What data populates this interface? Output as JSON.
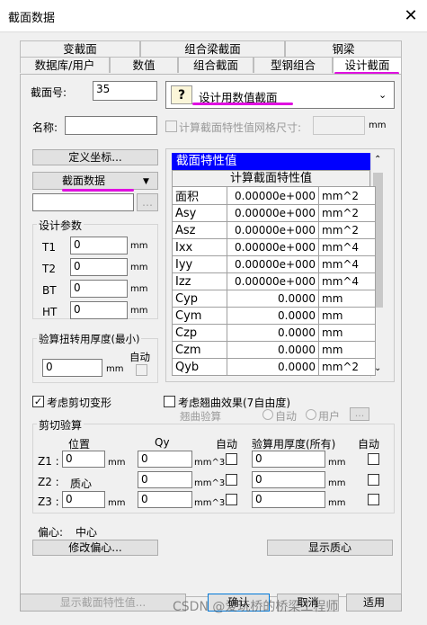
{
  "window": {
    "title": "截面数据",
    "close_glyph": "✕"
  },
  "tabs_back": [
    "变截面",
    "组合梁截面",
    "钢梁"
  ],
  "tabs_front": [
    "数据库/用户",
    "数值",
    "组合截面",
    "型钢组合",
    "设计截面"
  ],
  "section_no": {
    "label": "截面号:",
    "value": "35"
  },
  "section_type": {
    "value": "设计用数值截面"
  },
  "name": {
    "label": "名称:",
    "value": ""
  },
  "grid_size": {
    "label": "计算截面特性值网格尺寸:",
    "unit": "mm"
  },
  "define_coord_button": "定义坐标...",
  "section_data_dropdown": "截面数据",
  "design_params": {
    "title": "设计参数",
    "rows": [
      {
        "label": "T1",
        "value": "0",
        "unit": "mm"
      },
      {
        "label": "T2",
        "value": "0",
        "unit": "mm"
      },
      {
        "label": "BT",
        "value": "0",
        "unit": "mm"
      },
      {
        "label": "HT",
        "value": "0",
        "unit": "mm"
      }
    ]
  },
  "torsion": {
    "title": "验算扭转用厚度(最小)",
    "value": "0",
    "unit": "mm",
    "auto_label": "自动"
  },
  "props": {
    "header": "截面特性值",
    "calc_button": "计算截面特性值",
    "rows": [
      {
        "name": "面积",
        "value": "0.00000e+000",
        "unit": "mm^2"
      },
      {
        "name": "Asy",
        "value": "0.00000e+000",
        "unit": "mm^2"
      },
      {
        "name": "Asz",
        "value": "0.00000e+000",
        "unit": "mm^2"
      },
      {
        "name": "Ixx",
        "value": "0.00000e+000",
        "unit": "mm^4"
      },
      {
        "name": "Iyy",
        "value": "0.00000e+000",
        "unit": "mm^4"
      },
      {
        "name": "Izz",
        "value": "0.00000e+000",
        "unit": "mm^4"
      },
      {
        "name": "Cyp",
        "value": "0.0000",
        "unit": "mm"
      },
      {
        "name": "Cym",
        "value": "0.0000",
        "unit": "mm"
      },
      {
        "name": "Czp",
        "value": "0.0000",
        "unit": "mm"
      },
      {
        "name": "Czm",
        "value": "0.0000",
        "unit": "mm"
      },
      {
        "name": "Qyb",
        "value": "0.0000",
        "unit": "mm^2"
      }
    ]
  },
  "shear_deform": {
    "label": "考虑剪切变形",
    "checked": true
  },
  "warping": {
    "label": "考虑翘曲效果(7自由度)",
    "sub_label": "翘曲验算",
    "auto": "自动",
    "user": "用户",
    "more": "..."
  },
  "shear_check": {
    "title": "剪切验算",
    "col_pos": "位置",
    "col_qy": "Qy",
    "col_auto": "自动",
    "col_thk": "验算用厚度(所有)",
    "col_auto2": "自动",
    "rows": [
      {
        "label": "Z1 :",
        "mid": "",
        "pos": "0",
        "pos_unit": "mm",
        "qy": "0",
        "qy_unit": "mm^3",
        "thk": "0",
        "thk_unit": "mm"
      },
      {
        "label": "Z2 :",
        "mid": "质心",
        "pos": "",
        "pos_unit": "",
        "qy": "0",
        "qy_unit": "mm^3",
        "thk": "0",
        "thk_unit": "mm"
      },
      {
        "label": "Z3 :",
        "mid": "",
        "pos": "0",
        "pos_unit": "mm",
        "qy": "0",
        "qy_unit": "mm^3",
        "thk": "0",
        "thk_unit": "mm"
      }
    ]
  },
  "eccentric": {
    "label": "偏心:",
    "value": "中心",
    "modify_button": "修改偏心...",
    "show_centroid_button": "显示质心"
  },
  "footer": {
    "show_props": "显示截面特性值...",
    "ok": "确认",
    "cancel": "取消",
    "apply": "适用"
  },
  "watermark": "CSDN @爱玩桥的桥梁工程师",
  "colors": {
    "highlight": "#0000ff",
    "annotation": "#e010e0"
  }
}
